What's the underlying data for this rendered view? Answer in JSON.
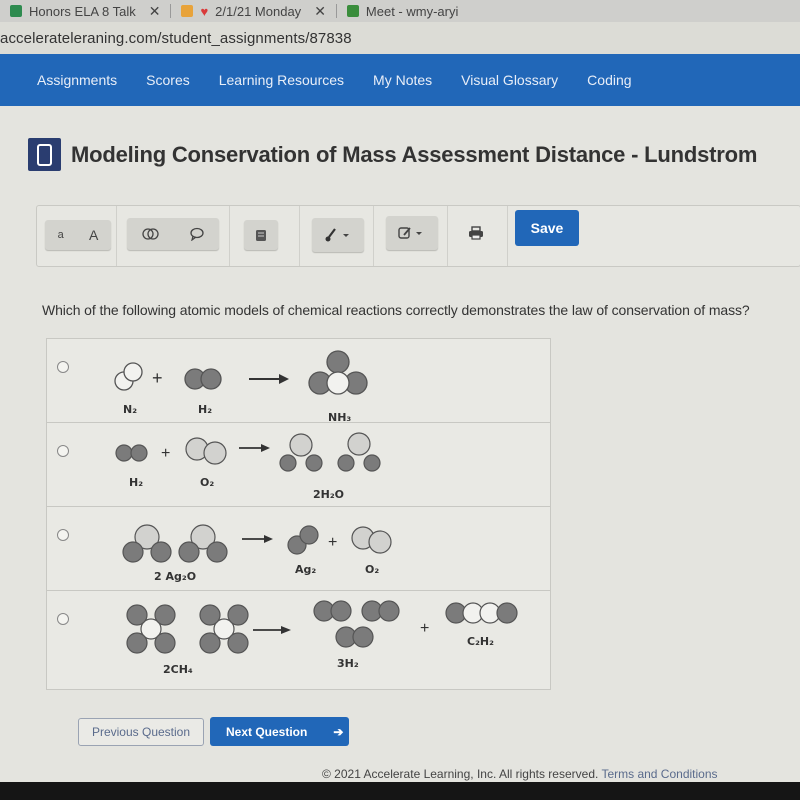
{
  "browser": {
    "tabs": [
      {
        "label": "Honors ELA 8 Talk",
        "icon": "classroom-icon",
        "color": "#2e8b4f"
      },
      {
        "label": "2/1/21 Monday",
        "icon": "heart-icon",
        "color": "#d93a3a"
      },
      {
        "label": "Meet - wmy-aryi",
        "icon": "meet-icon",
        "color": "#3a8d3c"
      }
    ],
    "close_glyph": "✕",
    "url": "accelerateleraning.com/student_assignments/87838"
  },
  "nav": {
    "items": [
      "Assignments",
      "Scores",
      "Learning Resources",
      "My Notes",
      "Visual Glossary",
      "Coding"
    ]
  },
  "header": {
    "title": "Modeling Conservation of Mass Assessment Distance - Lundstrom",
    "icon": "tablet-icon"
  },
  "toolbar": {
    "font_small": "a",
    "font_large": "A",
    "save_label": "Save",
    "icons": [
      "overlap-circles-icon",
      "speech-bubble-icon",
      "notebook-icon",
      "paintbrush-icon",
      "edit-icon",
      "print-icon"
    ]
  },
  "question": {
    "text": "Which of the following atomic models of chemical reactions correctly demonstrates the law of conservation of mass?",
    "options": [
      {
        "reactants": [
          "N₂",
          "H₂"
        ],
        "products": [
          "NH₃"
        ],
        "plus": "+"
      },
      {
        "reactants": [
          "H₂",
          "O₂"
        ],
        "products": [
          "2H₂O"
        ],
        "plus": "+"
      },
      {
        "reactants": [
          "2 Ag₂O"
        ],
        "products": [
          "Ag₂",
          "O₂"
        ],
        "plus": "+"
      },
      {
        "reactants": [
          "2CH₄"
        ],
        "products": [
          "3H₂",
          "C₂H₂"
        ],
        "plus": "+"
      }
    ]
  },
  "buttons": {
    "previous": "Previous Question",
    "next": "Next Question",
    "next_arrow": "➔"
  },
  "footer": {
    "copyright": "© 2021 Accelerate Learning, Inc. All rights reserved.",
    "terms": "Terms and Conditions"
  },
  "colors": {
    "brand_blue": "#2167b8",
    "atom_dark": "#7b7b7b",
    "atom_light": "#d2d2cf",
    "atom_white": "#f2f2ef"
  }
}
